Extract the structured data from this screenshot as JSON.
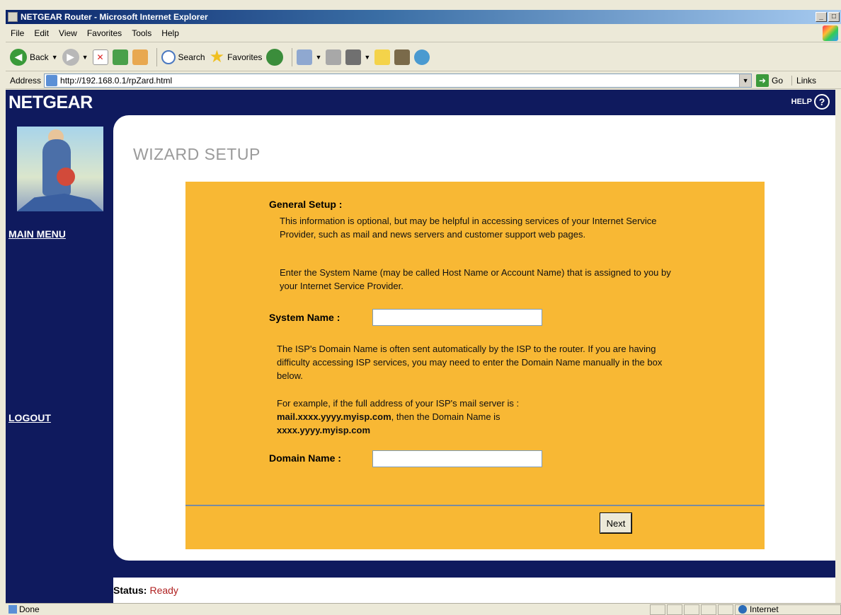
{
  "window": {
    "title": "NETGEAR Router - Microsoft Internet Explorer"
  },
  "menu": {
    "items": [
      "File",
      "Edit",
      "View",
      "Favorites",
      "Tools",
      "Help"
    ]
  },
  "toolbar": {
    "back": "Back",
    "search": "Search",
    "favorites": "Favorites"
  },
  "address": {
    "label": "Address",
    "url": "http://192.168.0.1/rpZard.html",
    "go": "Go",
    "links": "Links"
  },
  "header": {
    "logo": "NETGEAR",
    "help": "HELP",
    "help_glyph": "?"
  },
  "sidebar": {
    "main_menu": "MAIN MENU",
    "logout": "LOGOUT"
  },
  "content": {
    "title": "WIZARD SETUP",
    "section_title": "General Setup :",
    "para1": "This information is optional, but may be helpful in accessing services of your Internet Service Provider, such as mail and news servers and customer support web pages.",
    "para2": "Enter the System Name (may be called Host Name or Account Name) that is assigned to you by your Internet Service Provider.",
    "system_name_label": "System Name :",
    "system_name_value": "",
    "para3": "The ISP's Domain Name is often sent automatically by the ISP to the router. If you are having difficulty accessing ISP services, you may need to enter the Domain Name manually in the box below.",
    "para4_prefix": "For example, if the full address of your ISP's mail server is :",
    "para4_mail": "mail.xxxx.yyyy.myisp.com",
    "para4_mid": ", then the Domain Name is",
    "para4_domain": "xxxx.yyyy.myisp.com",
    "domain_name_label": "Domain Name :",
    "domain_name_value": "",
    "next_button": "Next"
  },
  "page_status": {
    "label": "Status:",
    "value": "Ready"
  },
  "browser_status": {
    "left": "Done",
    "zone": "Internet"
  }
}
